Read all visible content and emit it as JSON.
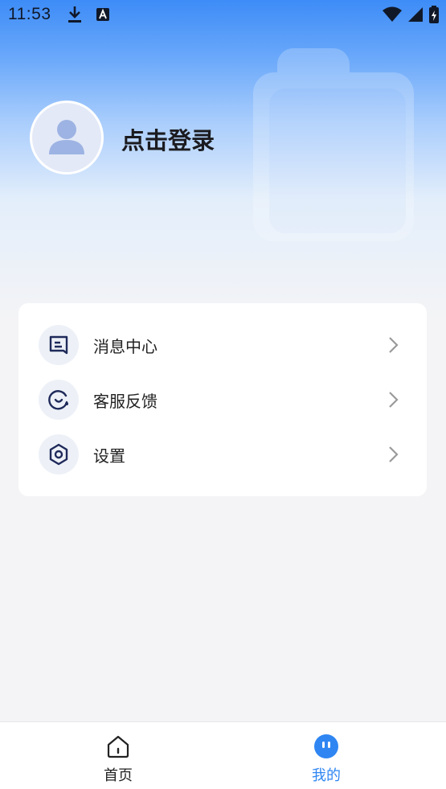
{
  "status_bar": {
    "time": "11:53",
    "icons": [
      "download-icon",
      "a11y-app-icon",
      "wifi-icon",
      "signal-icon",
      "battery-icon"
    ]
  },
  "profile": {
    "login_label": "点击登录",
    "avatar_icon": "user-avatar-icon"
  },
  "menu": {
    "items": [
      {
        "label": "消息中心",
        "icon": "message-icon"
      },
      {
        "label": "客服反馈",
        "icon": "customer-service-icon"
      },
      {
        "label": "设置",
        "icon": "settings-icon"
      }
    ]
  },
  "tabbar": {
    "tabs": [
      {
        "label": "首页",
        "icon": "home-icon",
        "active": false
      },
      {
        "label": "我的",
        "icon": "mine-icon",
        "active": true
      }
    ]
  },
  "colors": {
    "accent": "#2f86f2",
    "hero_top": "#3d8cf7",
    "icon_dark": "#1f2a5a",
    "background": "#f4f4f6"
  }
}
